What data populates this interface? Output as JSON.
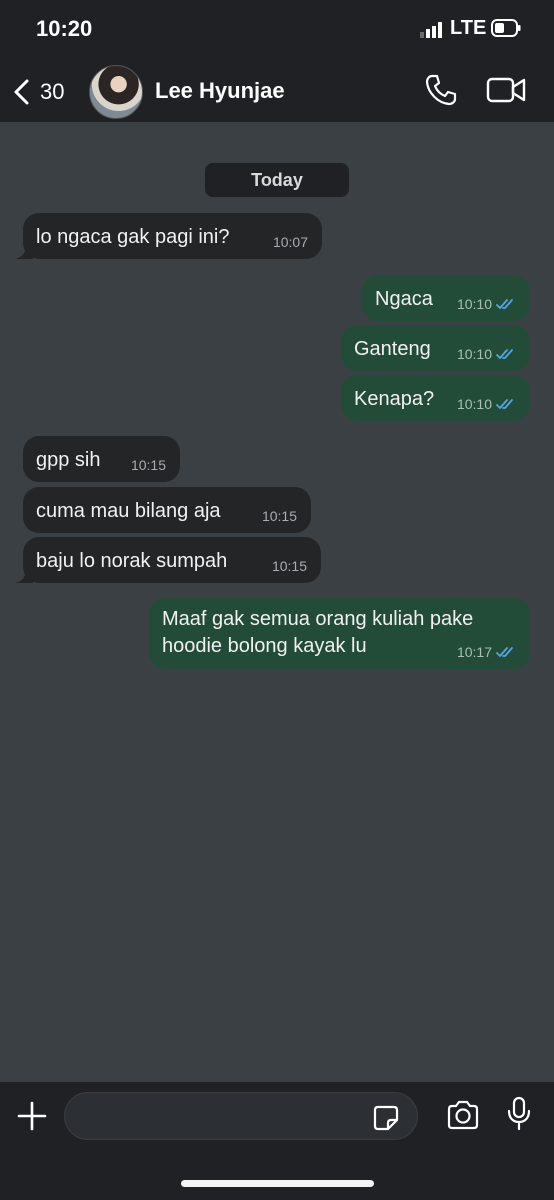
{
  "status_bar": {
    "time": "10:20",
    "network": "LTE"
  },
  "header": {
    "back_count": "30",
    "contact_name": "Lee Hyunjae",
    "icons": [
      "chevron-left-icon",
      "phone-icon",
      "video-camera-icon"
    ]
  },
  "chat": {
    "date_label": "Today",
    "messages": [
      {
        "direction": "in",
        "text": "lo ngaca gak pagi ini?",
        "time": "10:07"
      },
      {
        "direction": "out",
        "text": "Ngaca",
        "time": "10:10",
        "read": true
      },
      {
        "direction": "out",
        "text": "Ganteng",
        "time": "10:10",
        "read": true
      },
      {
        "direction": "out",
        "text": "Kenapa?",
        "time": "10:10",
        "read": true
      },
      {
        "direction": "in",
        "text": "gpp sih",
        "time": "10:15"
      },
      {
        "direction": "in",
        "text": "cuma mau bilang aja",
        "time": "10:15"
      },
      {
        "direction": "in",
        "text": "baju lo norak sumpah",
        "time": "10:15"
      },
      {
        "direction": "out",
        "text": "Maaf gak semua orang kuliah pake hoodie bolong kayak lu",
        "time": "10:17",
        "read": true
      }
    ]
  },
  "composer": {
    "input_value": "",
    "icons": [
      "plus-icon",
      "sticker-icon",
      "camera-icon",
      "microphone-icon"
    ]
  },
  "colors": {
    "chat_background": "#3b4045",
    "bar_background": "#1f2124",
    "incoming_bubble": "#232527",
    "outgoing_bubble": "#224c38",
    "read_ticks": "#4fa6e8"
  }
}
